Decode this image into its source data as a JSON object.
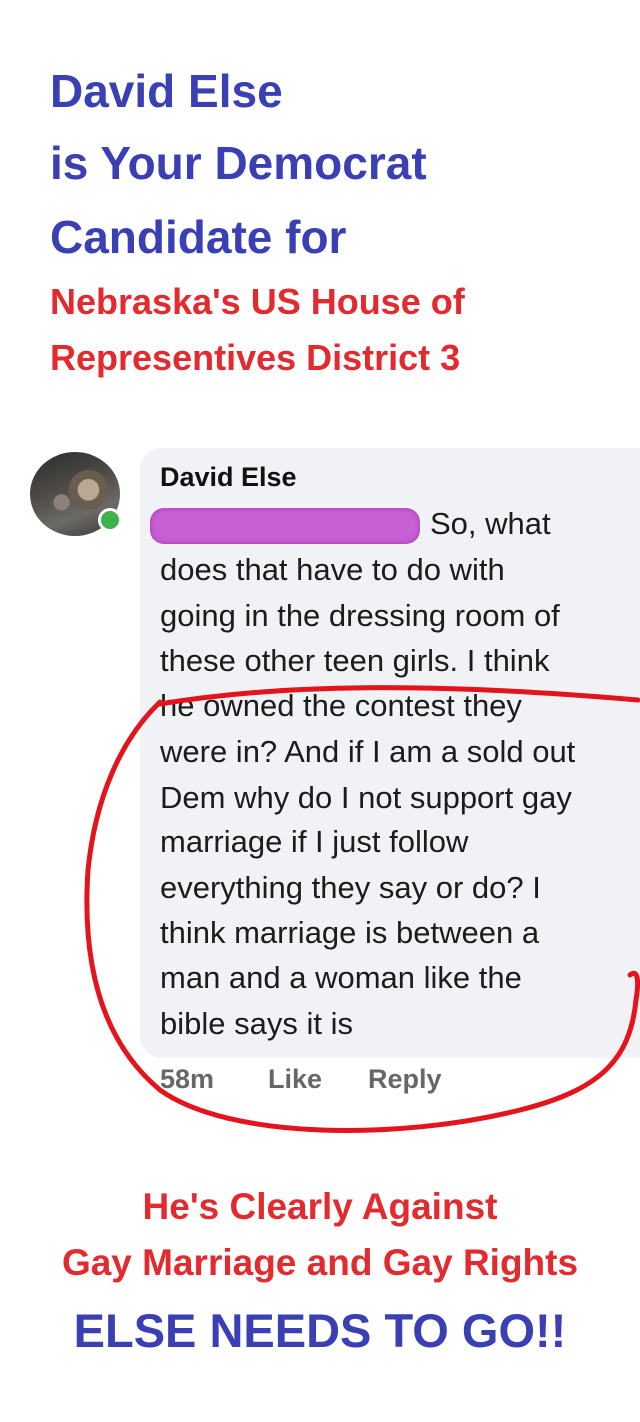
{
  "header": {
    "line1": "David Else",
    "line2": "is Your Democrat",
    "line3": "Candidate for",
    "line4": "Nebraska's US House of",
    "line5": "Representives District 3"
  },
  "comment": {
    "author": "David Else",
    "lines": [
      "So, what",
      "does that have to do with",
      "going in the dressing room of",
      "these other teen girls. I think",
      "he owned the contest they",
      "were in? And if I am a sold out",
      "Dem why do I not support gay",
      "marriage if I just follow",
      "everything they say or do? I",
      "think marriage is between a",
      "man and a woman like the",
      "bible says it is"
    ],
    "time": "58m",
    "like_label": "Like",
    "reply_label": "Reply"
  },
  "footer": {
    "line1": "He's Clearly Against",
    "line2": "Gay Marriage and Gay Rights",
    "line3": "ELSE NEEDS TO GO!!"
  },
  "colors": {
    "headline_blue": "#3a3fb4",
    "headline_red": "#e22a2f",
    "annotation_red": "#e3141b",
    "redaction_purple": "#c95fd4"
  }
}
